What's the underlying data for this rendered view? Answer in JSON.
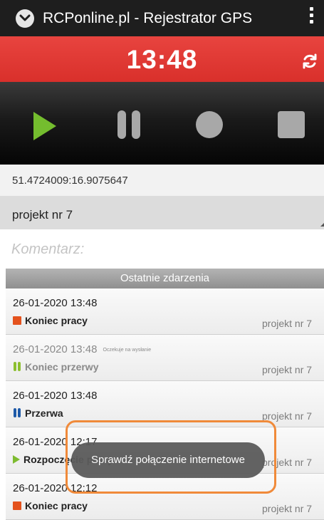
{
  "app": {
    "title": "RCPonline.pl - Rejestrator GPS",
    "icon": "app-logo-chevron-icon",
    "menu_icon": "more-vert-icon"
  },
  "clock": {
    "time": "13:48",
    "sync_icon": "sync-icon"
  },
  "controls": {
    "play_icon": "play-icon",
    "pause_icon": "pause-icon",
    "record_icon": "record-icon",
    "stop_icon": "stop-icon"
  },
  "location": {
    "coordinates": "51.4724009:16.9075647"
  },
  "project_select": {
    "selected": "projekt nr 7"
  },
  "comment": {
    "placeholder": "Komentarz:",
    "value": ""
  },
  "events_header": "Ostatnie zdarzenia",
  "events": [
    {
      "datetime": "26-01-2020 13:48",
      "type": "Koniec pracy",
      "project": "projekt nr 7",
      "pending_note": "",
      "icon": "stop-square-icon"
    },
    {
      "datetime": "26-01-2020 13:48",
      "type": "Koniec przerwy",
      "project": "projekt nr 7",
      "pending_note": "Oczekuje na wysłanie",
      "icon": "pause-green-icon"
    },
    {
      "datetime": "26-01-2020 13:48",
      "type": "Przerwa",
      "project": "projekt nr 7",
      "pending_note": "",
      "icon": "pause-blue-icon"
    },
    {
      "datetime": "26-01-2020 12:17",
      "type": "Rozpoczęcie pracy",
      "project": "projekt nr 7",
      "pending_note": "",
      "icon": "play-icon"
    },
    {
      "datetime": "26-01-2020 12:12",
      "type": "Koniec pracy",
      "project": "projekt nr 7",
      "pending_note": "",
      "icon": "stop-square-icon"
    }
  ],
  "toast": {
    "message": "Sprawdź połączenie internetowe"
  },
  "colors": {
    "clock_bar": "#e03a35",
    "play": "#74bd2e",
    "inactive_control": "#a8a8a8",
    "stop_event": "#e4521d",
    "pause_blue": "#1e5aa8",
    "pause_green": "#8cbf2e",
    "highlight": "#f08a3a"
  }
}
